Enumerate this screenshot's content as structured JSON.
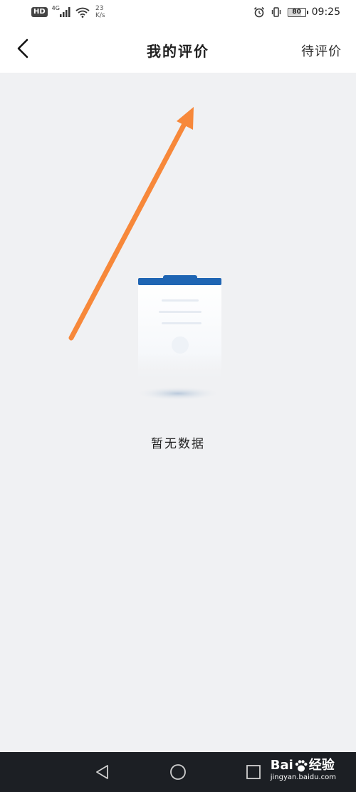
{
  "status_bar": {
    "hd": "HD",
    "network": "4G",
    "speed_value": "23",
    "speed_unit": "K/s",
    "battery": "80",
    "time": "09:25"
  },
  "nav": {
    "title": "我的评价",
    "action": "待评价"
  },
  "empty_state": {
    "text": "暂无数据"
  },
  "watermark": {
    "brand_left": "Bai",
    "brand_right": "经验",
    "url": "jingyan.baidu.com"
  },
  "colors": {
    "arrow": "#f7883a",
    "clipboard_blue": "#1f65b3",
    "background": "#f0f1f3",
    "sys_nav": "#1c1f24"
  },
  "icons": [
    "back-arrow-icon",
    "signal-icon",
    "wifi-icon",
    "alarm-icon",
    "vibrate-icon",
    "battery-icon",
    "nav-back-icon",
    "nav-home-icon",
    "nav-recents-icon",
    "paw-icon"
  ]
}
